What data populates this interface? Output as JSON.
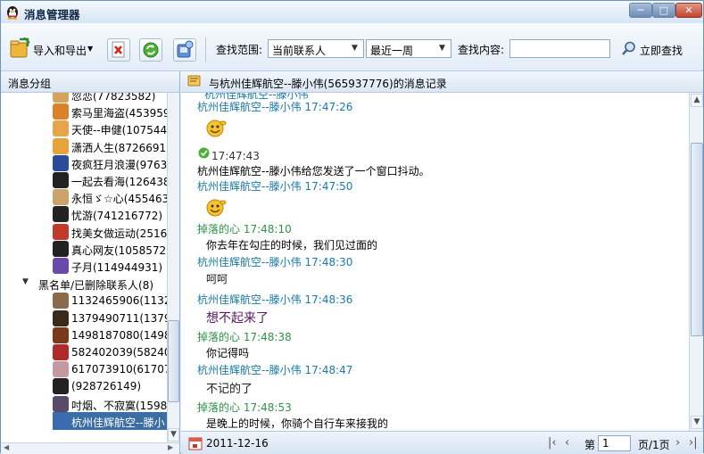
{
  "window": {
    "title": "消息管理器",
    "minimize_label": "─",
    "maximize_label": "□",
    "close_label": "✕"
  },
  "toolbar": {
    "import_export_label": "导入和导出",
    "search_scope_label": "查找范围:",
    "scope_value": "当前联系人",
    "time_value": "最近一周",
    "search_content_label": "查找内容:",
    "search_input_value": "",
    "search_now_label": "立即查找"
  },
  "sidebar": {
    "header": "消息分组",
    "contacts": [
      {
        "label": "忽恋(77823582)",
        "avatar_color": "#d8a25a"
      },
      {
        "label": "索马里海盗(4539595",
        "avatar_color": "#d9822b"
      },
      {
        "label": "天使--申健(1075441",
        "avatar_color": "#e7a44a"
      },
      {
        "label": "潇洒人生(87266918)",
        "avatar_color": "#e8a23a"
      },
      {
        "label": "夜疯狂月浪漫(97632",
        "avatar_color": "#2a4a9a"
      },
      {
        "label": "一起去看海(1264381",
        "avatar_color": "#222222"
      },
      {
        "label": "永恒ゞ☆心(4554638",
        "avatar_color": "#c9a26c"
      },
      {
        "label": "忧游(741216772)",
        "avatar_color": "#222222"
      },
      {
        "label": "找美女做运动(25164",
        "avatar_color": "#c0392b"
      },
      {
        "label": "真心网友(10585727",
        "avatar_color": "#222222"
      },
      {
        "label": "子月(114944931)",
        "avatar_color": "#6a4aa8"
      }
    ],
    "blacklist_group": "黑名单/已删除联系人(8)",
    "blacklist": [
      {
        "label": "1132465906(1132465",
        "avatar_color": "#8a6a4a"
      },
      {
        "label": "1379490711(1379490",
        "avatar_color": "#3a2a1a"
      },
      {
        "label": "1498187080(1498187",
        "avatar_color": "#7a3a1a"
      },
      {
        "label": "582402039(58240203",
        "avatar_color": "#b02a2a"
      },
      {
        "label": "617073910(61707391",
        "avatar_color": "#c49aa0"
      },
      {
        "label": "(928726149)",
        "avatar_color": "#222222"
      },
      {
        "label": "吋烟、不寂寞(15985",
        "avatar_color": "#5a4a6a"
      },
      {
        "label": "杭州佳辉航空--滕小",
        "avatar_color": "#3a6ab0"
      }
    ]
  },
  "conversation": {
    "header": "与杭州佳辉航空--滕小伟(565937776)的消息记录",
    "partial_top": "杭州佳辉航空--滕小伟",
    "messages": [
      {
        "sender": "杭州佳辉航空--滕小伟",
        "time": "17:47:26",
        "kind": "emoji"
      },
      {
        "time": "17:47:43",
        "kind": "system",
        "text": "杭州佳辉航空--滕小伟给您发送了一个窗口抖动。"
      },
      {
        "sender": "杭州佳辉航空--滕小伟",
        "time": "17:47:50",
        "kind": "emoji"
      },
      {
        "sender": "掉落的心",
        "time": "17:48:10",
        "text": "你去年在勾庄的时候，我们见过面的"
      },
      {
        "sender": "杭州佳辉航空--滕小伟",
        "time": "17:48:30",
        "text": "呵呵"
      },
      {
        "sender": "杭州佳辉航空--滕小伟",
        "time": "17:48:36",
        "text": "想不起来了"
      },
      {
        "sender": "掉落的心",
        "time": "17:48:38",
        "text": "你记得吗"
      },
      {
        "sender": "杭州佳辉航空--滕小伟",
        "time": "17:48:47",
        "text": "不记的了"
      },
      {
        "sender": "掉落的心",
        "time": "17:48:53",
        "text": "是晚上的时候，你骑个自行车来接我的"
      }
    ]
  },
  "statusbar": {
    "date": "2011-12-16",
    "page_prefix": "第",
    "page_value": "1",
    "page_suffix": "页/1页"
  },
  "colors": {
    "accent": "#3a6ea5",
    "sender_partner": "#1a7aa8",
    "sender_self": "#2e9148"
  }
}
